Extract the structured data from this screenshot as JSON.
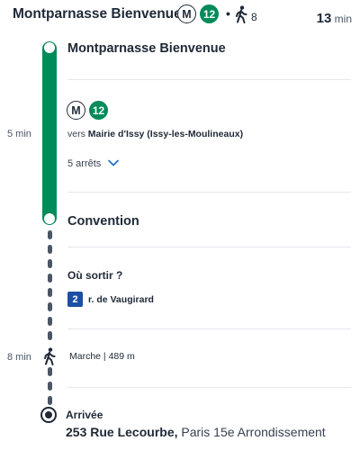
{
  "colors": {
    "line_12": "#008b5a",
    "exit_badge": "#1d4fa3",
    "text": "#1f2937"
  },
  "header": {
    "title": "Montparnasse Bienvenue",
    "metro_symbol": "M",
    "line_number": "12",
    "separator": "•",
    "walk_icon": "walking-person-icon",
    "walk_count": "8",
    "duration_value": "13",
    "duration_unit": "min"
  },
  "metro_leg": {
    "start_stop": "Montparnasse Bienvenue",
    "metro_symbol": "M",
    "line_number": "12",
    "duration": "5 min",
    "direction_prefix": "vers",
    "direction_name": "Mairie d'Issy (Issy-les-Moulineaux)",
    "stops_count": "5 arrêts",
    "chevron_icon": "chevron-down-icon",
    "end_stop": "Convention"
  },
  "exit": {
    "title": "Où sortir ?",
    "badge": "2",
    "street": "r. de Vaugirard"
  },
  "walk_leg": {
    "duration": "8 min",
    "icon": "walking-person-icon",
    "text": "Marche | 489 m"
  },
  "arrival": {
    "label": "Arrivée",
    "address_bold": "253 Rue Lecourbe,",
    "address_rest": "Paris 15e Arrondissement"
  }
}
